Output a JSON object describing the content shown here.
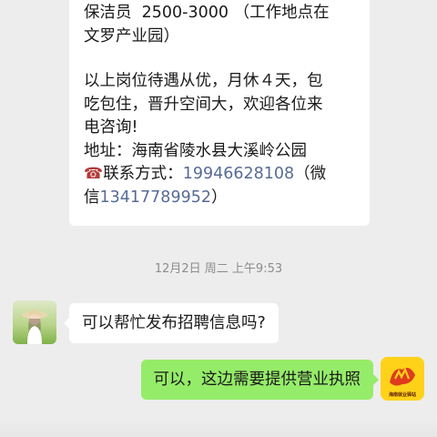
{
  "chat": {
    "message_top": {
      "line1": "保洁员  2500-3000 （工作地点在",
      "line2": "文罗产业园）",
      "line3": "以上岗位待遇从优，月休４天，包",
      "line4": "吃包住，晋升空间大，欢迎各位来",
      "line5": "电咨询!",
      "line6": "地址：海南省陵水县大溪岭公园",
      "line7_prefix": "联系方式：",
      "phone1": "19946628108",
      "line7_suffix": "（微",
      "line8_prefix": "信",
      "phone2": "13417789952",
      "line8_suffix": "）",
      "phone_icon": "☎"
    },
    "timestamp": "12月2日 周二 上午9:53",
    "message_in": "可以帮忙发布招聘信息吗?",
    "message_out": "可以，这边需要提供营业执照",
    "right_avatar_text": "海南就业驿站"
  },
  "colors": {
    "background": "#ededed",
    "bubble_in": "#ffffff",
    "bubble_out": "#95ec69",
    "link": "#576b95",
    "timestamp": "#8c8c8c"
  },
  "icons": {
    "left_avatar": "girl-with-hat-avatar",
    "right_avatar": "job-station-logo-avatar",
    "phone": "phone-icon"
  }
}
